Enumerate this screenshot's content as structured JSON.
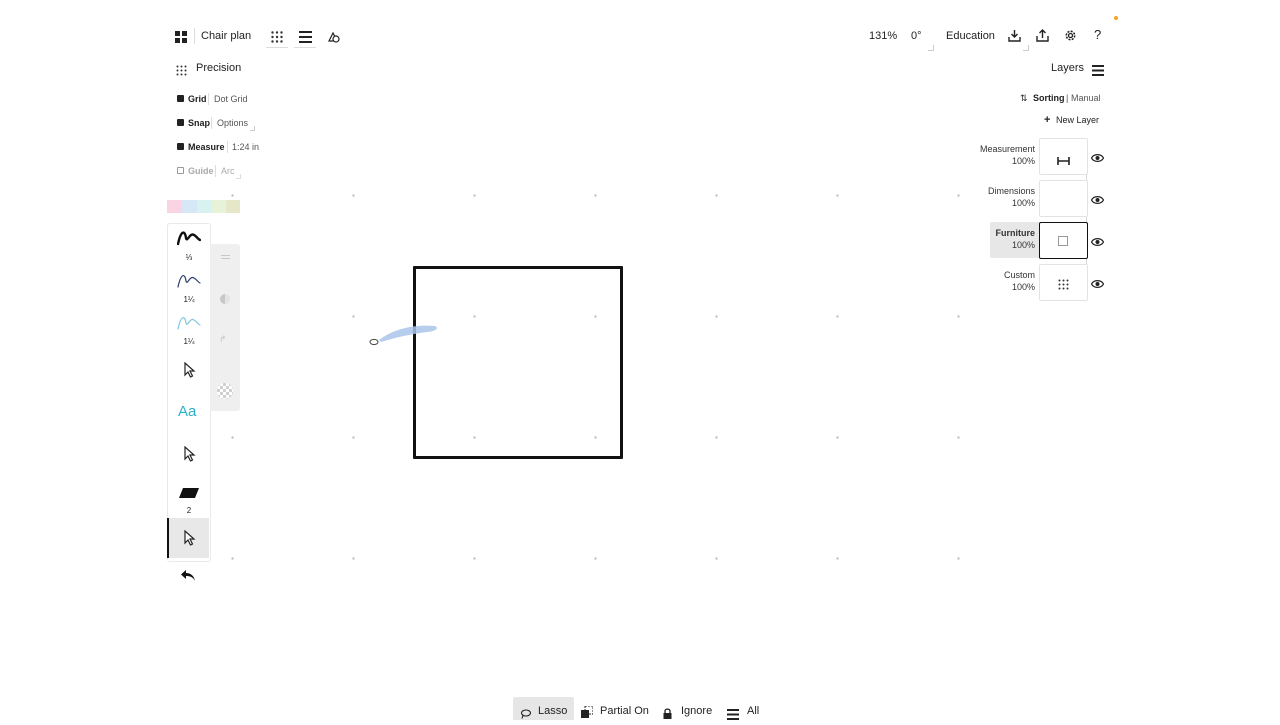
{
  "topbar": {
    "doc_title": "Chair plan",
    "zoom": "131%",
    "rotation": "0°",
    "mode": "Education",
    "icons": [
      "grid-menu-icon",
      "dot-grid-icon",
      "lines-menu-icon",
      "shapes-icon",
      "download-icon",
      "share-icon",
      "gear-icon",
      "help-icon"
    ]
  },
  "precision": {
    "title": "Precision",
    "rows": [
      {
        "label": "Grid",
        "value": "Dot Grid",
        "enabled": true
      },
      {
        "label": "Snap",
        "value": "Options",
        "enabled": true
      },
      {
        "label": "Measure",
        "value": "1:24 in",
        "enabled": true
      },
      {
        "label": "Guide",
        "value": "Arc",
        "enabled": false
      }
    ]
  },
  "swatches": [
    "#fbd4e3",
    "#d6e8f5",
    "#d8f1f1",
    "#e7f3d8",
    "#e6e6c9"
  ],
  "tools": [
    {
      "name": "pen",
      "label": "⅓"
    },
    {
      "name": "pencil",
      "label": "1¼"
    },
    {
      "name": "marker",
      "label": "1¼"
    },
    {
      "name": "select-1",
      "label": ""
    },
    {
      "name": "text",
      "label": "Aa"
    },
    {
      "name": "select-2",
      "label": ""
    },
    {
      "name": "eraser",
      "label": "2"
    },
    {
      "name": "select-active",
      "label": ""
    }
  ],
  "layers": {
    "title": "Layers",
    "sorting_label": "Sorting",
    "sorting_value": "Manual",
    "new_layer": "New Layer",
    "items": [
      {
        "name": "Measurement",
        "opacity": "100%",
        "active": false
      },
      {
        "name": "Dimensions",
        "opacity": "100%",
        "active": false
      },
      {
        "name": "Furniture",
        "opacity": "100%",
        "active": true
      },
      {
        "name": "Custom",
        "opacity": "100%",
        "active": false
      }
    ]
  },
  "bottombar": {
    "lasso": "Lasso",
    "partial": "Partial On",
    "ignore": "Ignore",
    "all": "All"
  },
  "colors": {
    "accent": "#f5a623",
    "ink": "#111111",
    "highlight": "#a9c4ea"
  }
}
